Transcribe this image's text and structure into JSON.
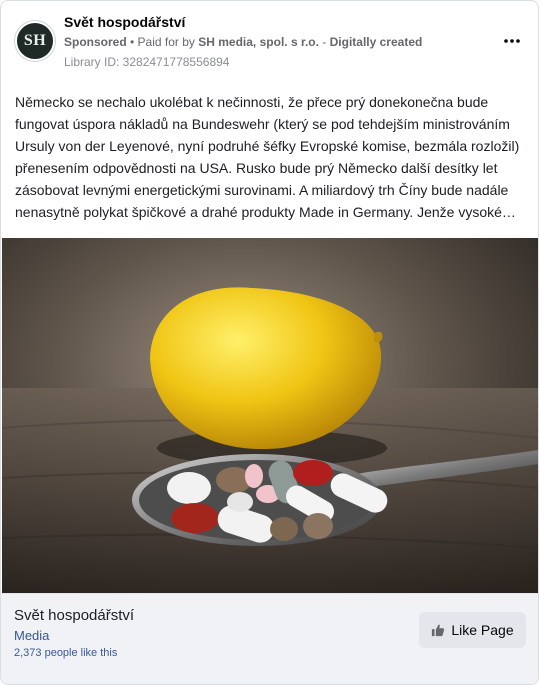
{
  "advertiser": {
    "avatar_text": "SH",
    "name": "Svět hospodářství",
    "sponsored_label": "Sponsored",
    "separator": " • ",
    "paid_for_label": "Paid for by ",
    "payer": "SH media, spol. s r.o.",
    "dash": " - ",
    "created_label": "Digitally created",
    "library_id": "Library ID: 3282471778556894"
  },
  "post": {
    "text": "Německo se nechalo ukolébat k nečinnosti, že přece prý donekonečna bude fungovat úspora nákladů na Bundeswehr (který se pod tehdejším ministrováním Ursuly von der Leyenové, nyní podruhé šéfky Evropské komise, bezmála rozložil) přenesením odpovědnosti na USA. Rusko bude prý Německo další desítky let zásobovat levnými energetickými surovinami. A miliardový trh Číny bude nadále nenasytně polykat špičkové a drahé produkty Made in Germany. Jenže vysoké ceny elektřiny a zemního plynu, které jsou na tří až sedminásobku ve srovnání s…"
  },
  "footer": {
    "page_name": "Svět hospodářství",
    "category": "Media",
    "likes": "2,373 people like this",
    "like_button": "Like Page"
  },
  "icons": {
    "more": "more-options-icon",
    "like": "thumbs-up-icon"
  },
  "colors": {
    "link": "#385898",
    "meta": "#65676b",
    "avatar_bg": "#1f2a26",
    "footer_bg": "#f0f2f5"
  }
}
